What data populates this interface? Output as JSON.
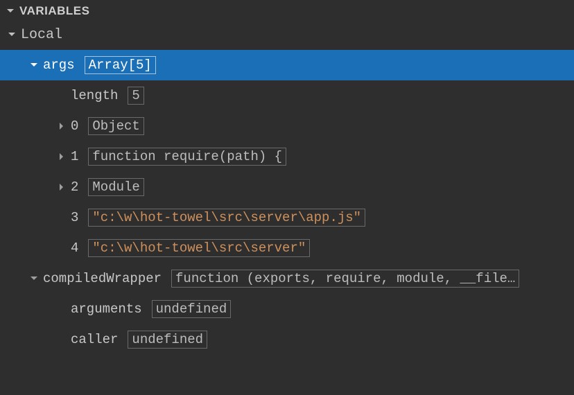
{
  "panel": {
    "title": "VARIABLES"
  },
  "scopes": [
    {
      "name": "Local",
      "expanded": true,
      "children": [
        {
          "name": "args",
          "value": "Array[5]",
          "expanded": true,
          "selected": true,
          "expandable": true,
          "children": [
            {
              "name": "length",
              "value": "5",
              "expandable": false
            },
            {
              "name": "0",
              "value": "Object",
              "expandable": true
            },
            {
              "name": "1",
              "value": "function require(path) {",
              "expandable": true
            },
            {
              "name": "2",
              "value": "Module",
              "expandable": true
            },
            {
              "name": "3",
              "value": "\"c:\\w\\hot-towel\\src\\server\\app.js\"",
              "kind": "string",
              "expandable": false
            },
            {
              "name": "4",
              "value": "\"c:\\w\\hot-towel\\src\\server\"",
              "kind": "string",
              "expandable": false
            }
          ]
        },
        {
          "name": "compiledWrapper",
          "value": "function (exports, require, module, __file…",
          "expanded": true,
          "expandable": true,
          "children": [
            {
              "name": "arguments",
              "value": "undefined",
              "expandable": false
            },
            {
              "name": "caller",
              "value": "undefined",
              "expandable": false
            }
          ]
        }
      ]
    }
  ]
}
